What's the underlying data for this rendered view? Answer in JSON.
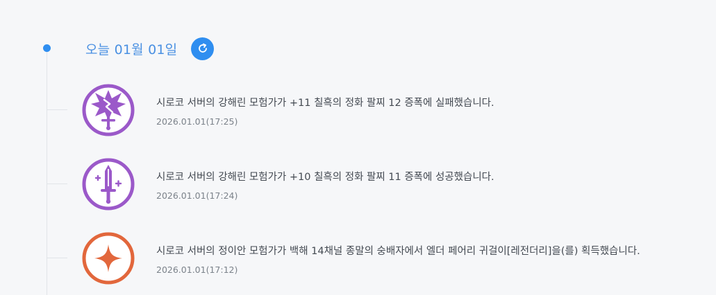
{
  "header": {
    "date_label": "오늘 01월 01일",
    "refresh_icon": "refresh-icon",
    "accent_color": "#2f8ef0"
  },
  "entries": [
    {
      "icon": "broken-sword-icon",
      "icon_color": "#9b59c9",
      "message": "시로코 서버의 강해린 모험가가 +11 칠흑의 정화 팔찌 12 증폭에 실패했습니다.",
      "time": "2026.01.01(17:25)"
    },
    {
      "icon": "sword-upgrade-icon",
      "icon_color": "#9b59c9",
      "message": "시로코 서버의 강해린 모험가가 +10 칠흑의 정화 팔찌 11 증폭에 성공했습니다.",
      "time": "2026.01.01(17:24)"
    },
    {
      "icon": "sparkle-icon",
      "icon_color": "#e2673c",
      "message": "시로코 서버의 정이안 모험가가 백해 14채널 종말의 숭배자에서 엘더 페어리 귀걸이[레전더리]을(를) 획득했습니다.",
      "time": "2026.01.01(17:12)"
    }
  ]
}
